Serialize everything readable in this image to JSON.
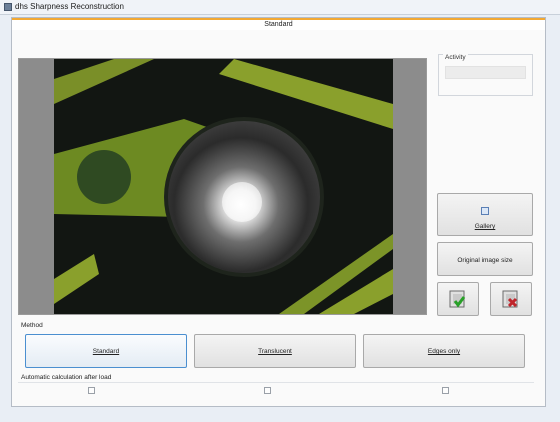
{
  "window": {
    "title": "dhs Sharpness Reconstruction"
  },
  "tabs": {
    "active_label": "Standard"
  },
  "activity": {
    "label": "Activity"
  },
  "buttons": {
    "gallery": "Gallery",
    "original_size": "Original image size",
    "open_icon": "open-image-icon",
    "close_icon": "close-image-icon"
  },
  "method": {
    "label": "Method",
    "options": [
      "Standard",
      "Translucent",
      "Edges only"
    ],
    "selected": "Standard"
  },
  "auto_calc": {
    "label": "Automatic calculation after load",
    "checked": [
      false,
      false,
      false
    ]
  }
}
